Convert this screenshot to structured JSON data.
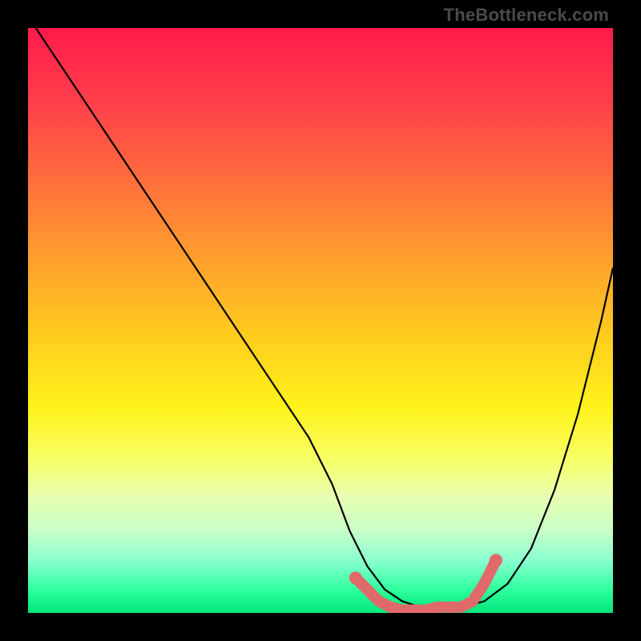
{
  "attribution": "TheBottleneck.com",
  "chart_data": {
    "type": "line",
    "title": "",
    "xlabel": "",
    "ylabel": "",
    "xlim": [
      0,
      100
    ],
    "ylim": [
      0,
      100
    ],
    "series": [
      {
        "name": "bottleneck-curve",
        "x": [
          0,
          6,
          12,
          18,
          24,
          30,
          36,
          42,
          48,
          52,
          55,
          58,
          61,
          64,
          67,
          70,
          74,
          78,
          82,
          86,
          90,
          94,
          98,
          100
        ],
        "values": [
          102,
          93,
          84,
          75,
          66,
          57,
          48,
          39,
          30,
          22,
          14,
          8,
          4,
          2,
          1,
          1,
          1,
          2,
          5,
          11,
          21,
          34,
          50,
          59
        ]
      },
      {
        "name": "flat-highlight",
        "x": [
          56,
          58,
          60,
          62,
          64,
          66,
          68,
          70,
          72,
          74,
          76,
          78,
          80
        ],
        "values": [
          6,
          4,
          2,
          1,
          0.5,
          0.5,
          0.5,
          1,
          1,
          1,
          2,
          5,
          9
        ]
      }
    ],
    "highlight_color": "#e06a6a",
    "curve_color": "#000000"
  }
}
